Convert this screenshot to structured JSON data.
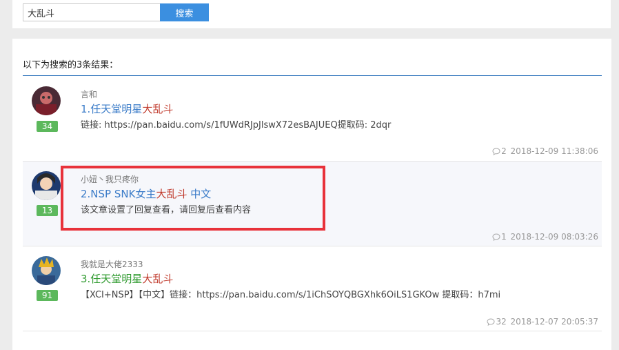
{
  "search": {
    "value": "大乱斗",
    "button_label": "搜索"
  },
  "results_header": "以下为搜索的3条结果：",
  "results": [
    {
      "count": "34",
      "author": "言和",
      "title_prefix": "1.任天堂明星",
      "title_highlight": "大乱斗",
      "title_suffix": "",
      "excerpt": "链接: https://pan.baidu.com/s/1fUWdRJpJlswX72esBAJUEQ提取码: 2dqr",
      "comments": "2",
      "timestamp": "2018-12-09 11:38:06"
    },
    {
      "count": "13",
      "author": "小妞丶我只疼你",
      "title_prefix": "2.NSP SNK女主",
      "title_highlight": "大乱斗",
      "title_suffix": " 中文",
      "excerpt": "该文章设置了回复查看，请回复后查看内容",
      "comments": "1",
      "timestamp": "2018-12-09 08:03:26"
    },
    {
      "count": "91",
      "author": "我就是大佬2333",
      "title_prefix": "3.任天堂明星",
      "title_highlight": "大乱斗",
      "title_suffix": "",
      "excerpt": "【XCI+NSP】【中文】链接：https://pan.baidu.com/s/1iChSOYQBGXhk6OiLS1GKOw 提取码：h7mi",
      "comments": "32",
      "timestamp": "2018-12-07 20:05:37"
    }
  ],
  "colors": {
    "accent": "#3b8fe0",
    "highlight": "#c0392b",
    "link": "#3a7bc8",
    "badge": "#5cb85c",
    "annotation": "#e8323a"
  },
  "icons": {
    "comment": "comment-bubble-icon"
  }
}
